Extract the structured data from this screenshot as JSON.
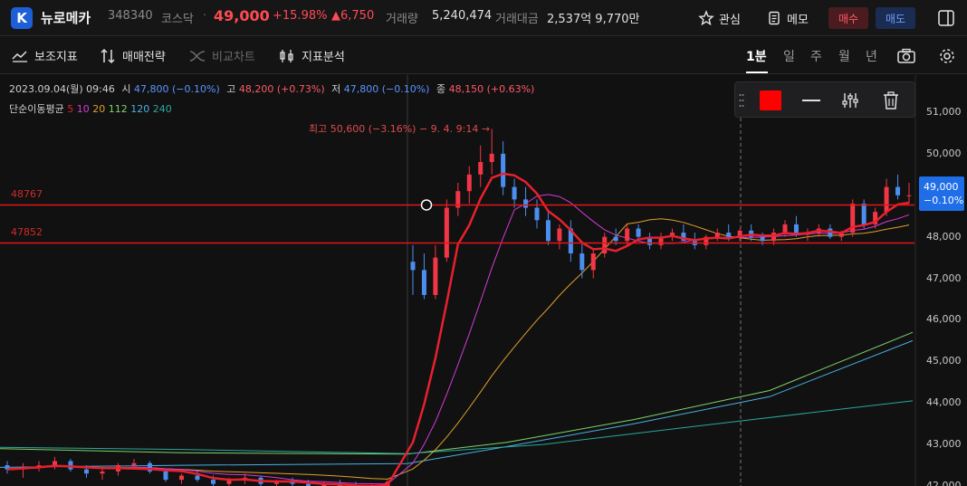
{
  "header": {
    "logo_letter": "K",
    "stock_name": "뉴로메카",
    "stock_code": "348340",
    "market": "코스닥",
    "separator": "·",
    "price": "49,000",
    "change_pct": "+15.98%",
    "change_abs": "▲6,750",
    "volume_label": "거래량",
    "volume": "5,240,474",
    "amount_label": "거래대금",
    "amount": "2,537억 9,770만",
    "watch_label": "관심",
    "memo_label": "메모",
    "buy_label": "매수",
    "sell_label": "매도"
  },
  "toolbar": {
    "indicators_label": "보조지표",
    "strategy_label": "매매전략",
    "compare_label": "비교차트",
    "analysis_label": "지표분석",
    "periods": [
      "1분",
      "일",
      "주",
      "월",
      "년"
    ],
    "active_period": "1분"
  },
  "chart_info": {
    "datetime": "2023.09.04(월) 09:46",
    "open_label": "시",
    "open_value": "47,800 (−0.10%)",
    "high_label": "고",
    "high_value": "48,200 (+0.73%)",
    "low_label": "저",
    "low_value": "47,800 (−0.10%)",
    "close_label": "종",
    "close_value": "48,150 (+0.63%)",
    "ma_label": "단순이동평균",
    "ma_periods": [
      {
        "value": "5",
        "color": "#e8212d"
      },
      {
        "value": "10",
        "color": "#d63ad6"
      },
      {
        "value": "20",
        "color": "#e0a028"
      },
      {
        "value": "112",
        "color": "#7ed36a"
      },
      {
        "value": "120",
        "color": "#4ab0e0"
      },
      {
        "value": "240",
        "color": "#2aa89a"
      }
    ],
    "high_annotation": "최고 50,600 (−3.16%) − 9. 4. 9:14 →",
    "hline_1": "48767",
    "hline_2": "47852",
    "current_price": "49,000",
    "current_pct": "−0.10%"
  },
  "y_axis_labels": [
    "51,000",
    "50,000",
    "48,000",
    "47,000",
    "46,000",
    "45,000",
    "44,000",
    "43,000",
    "42,000"
  ],
  "colors": {
    "up": "#f23645",
    "down": "#4b8ef0",
    "hline": "#e01818",
    "accent_blue": "#1f6ee8"
  },
  "chart_data": {
    "type": "line",
    "title": "뉴로메카 1분",
    "ylim": [
      42000,
      51500
    ],
    "horizontal_lines": [
      48767,
      47852
    ],
    "candles": [
      [
        42500,
        42600,
        42300,
        42400
      ],
      [
        42400,
        42550,
        42200,
        42450
      ],
      [
        42450,
        42600,
        42350,
        42500
      ],
      [
        42500,
        42700,
        42400,
        42600
      ],
      [
        42600,
        42650,
        42350,
        42400
      ],
      [
        42400,
        42500,
        42200,
        42300
      ],
      [
        42300,
        42450,
        42150,
        42350
      ],
      [
        42350,
        42550,
        42250,
        42500
      ],
      [
        42500,
        42650,
        42400,
        42550
      ],
      [
        42550,
        42600,
        42300,
        42350
      ],
      [
        42350,
        42400,
        42100,
        42150
      ],
      [
        42150,
        42300,
        42050,
        42250
      ],
      [
        42250,
        42350,
        42100,
        42150
      ],
      [
        42150,
        42250,
        41950,
        42050
      ],
      [
        42050,
        42200,
        41950,
        42150
      ],
      [
        42150,
        42300,
        42050,
        42200
      ],
      [
        42200,
        42250,
        42000,
        42050
      ],
      [
        42050,
        42150,
        41950,
        42100
      ],
      [
        42100,
        42200,
        42000,
        42050
      ],
      [
        42050,
        42150,
        41950,
        42000
      ],
      [
        42000,
        42100,
        41900,
        42050
      ],
      [
        42050,
        42150,
        41950,
        42000
      ],
      [
        42000,
        42100,
        41900,
        41950
      ],
      [
        41950,
        42050,
        41850,
        42000
      ],
      [
        42000,
        42150,
        41950,
        42100
      ],
      [
        47400,
        47800,
        46600,
        47200
      ],
      [
        47200,
        47600,
        46500,
        46600
      ],
      [
        46600,
        47800,
        46500,
        47500
      ],
      [
        47500,
        48900,
        47400,
        48700
      ],
      [
        48700,
        49300,
        48500,
        49100
      ],
      [
        49100,
        49700,
        48800,
        49500
      ],
      [
        49500,
        50200,
        49200,
        49800
      ],
      [
        49800,
        50600,
        49500,
        50000
      ],
      [
        50000,
        50300,
        49000,
        49200
      ],
      [
        49200,
        49400,
        48700,
        48900
      ],
      [
        48900,
        49200,
        48500,
        48700
      ],
      [
        48700,
        48900,
        48200,
        48400
      ],
      [
        48400,
        48600,
        47800,
        47900
      ],
      [
        47900,
        48300,
        47700,
        48200
      ],
      [
        48200,
        48400,
        47400,
        47600
      ],
      [
        47600,
        47900,
        47000,
        47200
      ],
      [
        47200,
        47700,
        47000,
        47600
      ],
      [
        47600,
        48100,
        47500,
        48000
      ],
      [
        48000,
        48200,
        47800,
        47900
      ],
      [
        47900,
        48300,
        47800,
        48200
      ],
      [
        48200,
        48300,
        47900,
        48000
      ],
      [
        48000,
        48100,
        47700,
        47800
      ],
      [
        47800,
        48100,
        47700,
        48000
      ],
      [
        48000,
        48200,
        47900,
        48100
      ],
      [
        48100,
        48300,
        47900,
        47900
      ],
      [
        47900,
        48100,
        47700,
        47800
      ],
      [
        47800,
        48050,
        47700,
        48000
      ],
      [
        48000,
        48200,
        47900,
        48100
      ],
      [
        48100,
        48300,
        47900,
        48000
      ],
      [
        48000,
        48200,
        47900,
        48150
      ],
      [
        48150,
        48300,
        47900,
        48000
      ],
      [
        48000,
        48100,
        47800,
        47900
      ],
      [
        47900,
        48200,
        47800,
        48100
      ],
      [
        48100,
        48400,
        48000,
        48300
      ],
      [
        48300,
        48500,
        48000,
        48050
      ],
      [
        48050,
        48200,
        47900,
        48100
      ],
      [
        48100,
        48300,
        48000,
        48200
      ],
      [
        48200,
        48300,
        47950,
        48000
      ],
      [
        48000,
        48150,
        47900,
        48100
      ],
      [
        48100,
        48900,
        48000,
        48800
      ],
      [
        48800,
        48900,
        48200,
        48300
      ],
      [
        48300,
        48700,
        48200,
        48600
      ],
      [
        48600,
        49400,
        48500,
        49200
      ],
      [
        49200,
        49500,
        48900,
        49000
      ],
      [
        49000,
        49300,
        48800,
        49000
      ]
    ]
  }
}
